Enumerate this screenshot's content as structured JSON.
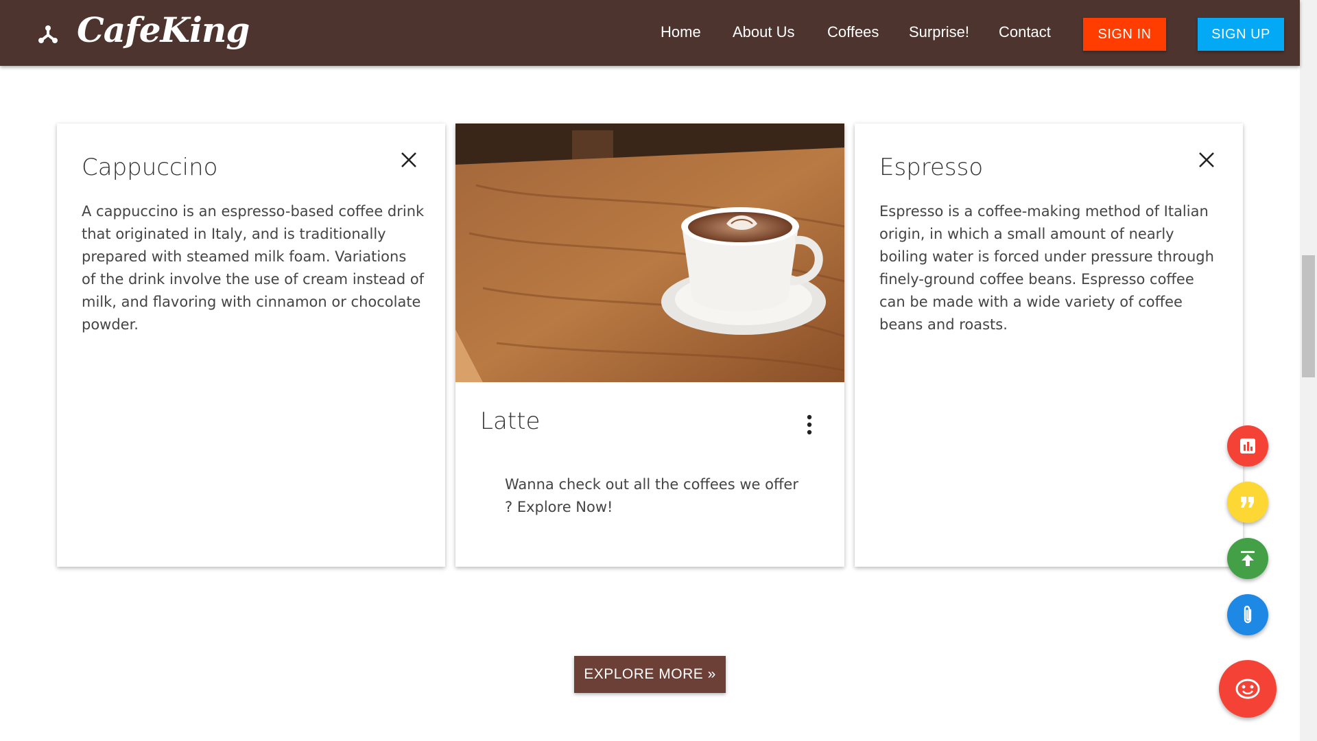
{
  "navbar": {
    "brand": "CafeKing",
    "brand_icon": "share-branch-icon",
    "links": [
      "Home",
      "About Us",
      "Coffees",
      "Surprise!",
      "Contact"
    ],
    "signin_label": "SIGN IN",
    "signup_label": "SIGN UP",
    "colors": {
      "background": "#4e342e",
      "signin": "#ff3d00",
      "signup": "#03a9f4"
    }
  },
  "cards": [
    {
      "title": "Cappuccino",
      "text": "A cappuccino is an espresso-based coffee drink that originated in Italy, and is traditionally prepared with steamed milk foam. Variations of the drink involve the use of cream instead of milk, and flavoring with cinnamon or chocolate powder.",
      "action_icon": "close-icon"
    },
    {
      "title": "Latte",
      "text": "Wanna check out all the coffees we offer ? Explore Now!",
      "action_icon": "more-vert-icon",
      "image": "latte-cup-on-wooden-table"
    },
    {
      "title": "Espresso",
      "text": "Espresso is a coffee-making method of Italian origin, in which a small amount of nearly boiling water is forced under pressure through finely-ground coffee beans. Espresso coffee can be made with a wide variety of coffee beans and roasts.",
      "action_icon": "close-icon"
    }
  ],
  "explore_button": {
    "label": "EXPLORE MORE »",
    "color": "#6d4037"
  },
  "fabs": [
    {
      "icon": "chart-icon",
      "color": "#f44336"
    },
    {
      "icon": "quote-icon",
      "color": "#fdd835"
    },
    {
      "icon": "publish-icon",
      "color": "#43a047"
    },
    {
      "icon": "attach-icon",
      "color": "#1e88e5"
    },
    {
      "icon": "face-icon",
      "color": "#f44336"
    }
  ]
}
